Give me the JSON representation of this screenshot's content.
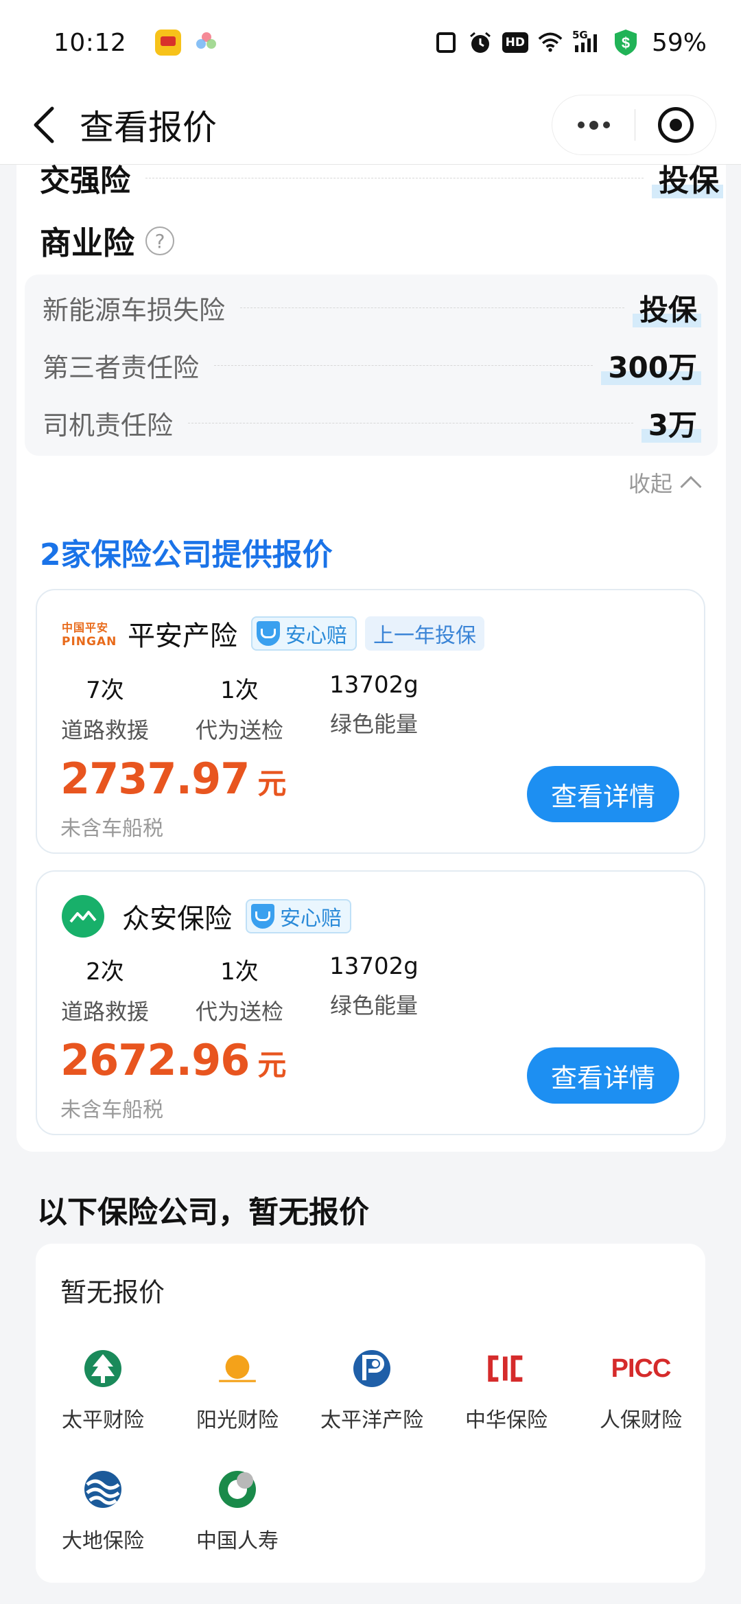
{
  "status_bar": {
    "time": "10:12",
    "five_g": "5G",
    "hd": "HD",
    "battery": "59%"
  },
  "nav": {
    "title": "查看报价"
  },
  "compulsory": {
    "label": "交强险",
    "value": "投保"
  },
  "commercial": {
    "title": "商业险",
    "help": "?",
    "items": [
      {
        "label": "新能源车损失险",
        "value": "投保"
      },
      {
        "label": "第三者责任险",
        "value": "300万"
      },
      {
        "label": "司机责任险",
        "value": "3万"
      }
    ],
    "collapse": "收起"
  },
  "quotes": {
    "title": "2家保险公司提供报价",
    "cards": [
      {
        "logo_top": "中国平安",
        "logo_bottom": "PINGAN",
        "name": "平安产险",
        "badge": "安心赔",
        "tag": "上一年投保",
        "stats": [
          {
            "value": "7次",
            "label": "道路救援"
          },
          {
            "value": "1次",
            "label": "代为送检"
          },
          {
            "value": "13702g",
            "label": "绿色能量"
          }
        ],
        "price": "2737.97",
        "unit": "元",
        "note": "未含车船税",
        "button": "查看详情"
      },
      {
        "name": "众安保险",
        "badge": "安心赔",
        "stats": [
          {
            "value": "2次",
            "label": "道路救援"
          },
          {
            "value": "1次",
            "label": "代为送检"
          },
          {
            "value": "13702g",
            "label": "绿色能量"
          }
        ],
        "price": "2672.96",
        "unit": "元",
        "note": "未含车船税",
        "button": "查看详情"
      }
    ]
  },
  "no_quote": {
    "title": "以下保险公司，暂无报价",
    "subtitle": "暂无报价",
    "companies": [
      {
        "name": "太平财险",
        "icon": "taiping-logo-icon"
      },
      {
        "name": "阳光财险",
        "icon": "sunshine-logo-icon"
      },
      {
        "name": "太平洋产险",
        "icon": "cpic-logo-icon"
      },
      {
        "name": "中华保险",
        "icon": "cic-logo-icon"
      },
      {
        "name": "人保财险",
        "icon": "picc-logo-icon",
        "logo_text": "PICC"
      },
      {
        "name": "大地保险",
        "icon": "dadi-logo-icon"
      },
      {
        "name": "中国人寿",
        "icon": "chinalife-logo-icon"
      }
    ]
  },
  "colors": {
    "accent_blue": "#1a73e8",
    "button_blue": "#1d8ff2",
    "price_orange": "#e8551f",
    "highlight": "#d5ebfa"
  }
}
